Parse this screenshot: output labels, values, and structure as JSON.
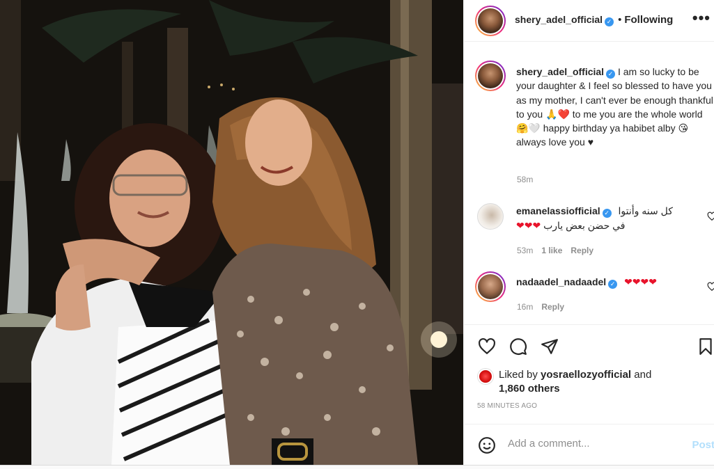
{
  "post": {
    "author": "shery_adel_official",
    "follow_status": "Following",
    "more_label": "•••"
  },
  "caption": {
    "username": "shery_adel_official",
    "text": "I am so lucky to be your daughter & I feel so blessed to have you as my mother, I can't ever be enough thankful to you 🙏❤️ to me you are the whole world 🤗🤍 happy birthday ya habibet alby 😘 always love you ♥",
    "time": "58m"
  },
  "comments": [
    {
      "username": "emanelassiofficial",
      "line1": "كل سنه وأنتوا",
      "line2": "في حضن بعض يارب",
      "hearts": "❤❤❤",
      "time": "53m",
      "likes": "1 like",
      "reply": "Reply"
    },
    {
      "username": "nadaadel_nadaadel",
      "hearts": "❤❤❤❤",
      "time": "16m",
      "reply": "Reply"
    }
  ],
  "likes": {
    "prefix": "Liked by",
    "user": "yosraellozyofficial",
    "and": "and",
    "others": "1,860 others"
  },
  "timestamp": "58 MINUTES AGO",
  "add_comment": {
    "placeholder": "Add a comment...",
    "post_label": "Post"
  },
  "icons": {
    "verified": "verified-badge-icon",
    "like": "heart-icon",
    "comment": "comment-bubble-icon",
    "share": "paper-plane-icon",
    "save": "bookmark-icon",
    "emoji": "smiley-icon"
  },
  "colors": {
    "verified": "#3897f0",
    "heart": "#e8132b",
    "post_disabled": "#b2dffc",
    "meta": "#8e8e8e"
  }
}
